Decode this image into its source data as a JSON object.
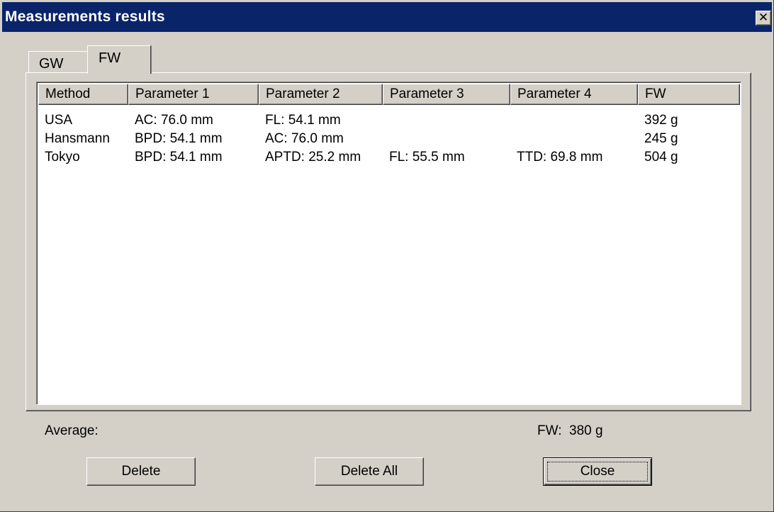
{
  "window": {
    "title": "Measurements results",
    "close_glyph": "✕"
  },
  "tabs": [
    {
      "label": "GW",
      "active": false
    },
    {
      "label": "FW",
      "active": true
    }
  ],
  "table": {
    "columns": [
      "Method",
      "Parameter 1",
      "Parameter 2",
      "Parameter 3",
      "Parameter 4",
      "FW"
    ],
    "rows": [
      [
        "USA",
        "AC: 76.0 mm",
        "FL: 54.1 mm",
        "",
        "",
        "392 g"
      ],
      [
        "Hansmann",
        "BPD: 54.1 mm",
        "AC: 76.0 mm",
        "",
        "",
        "245 g"
      ],
      [
        "Tokyo",
        "BPD: 54.1 mm",
        "APTD: 25.2 mm",
        "FL: 55.5 mm",
        "TTD: 69.8 mm",
        "504 g"
      ]
    ]
  },
  "summary": {
    "average_label": "Average:",
    "fw_label": "FW:",
    "fw_value": "380 g"
  },
  "buttons": {
    "delete": "Delete",
    "delete_all": "Delete All",
    "close": "Close"
  },
  "colors": {
    "titlebar": "#0a246a",
    "face": "#d4d0c8",
    "list_bg": "#ffffff"
  }
}
